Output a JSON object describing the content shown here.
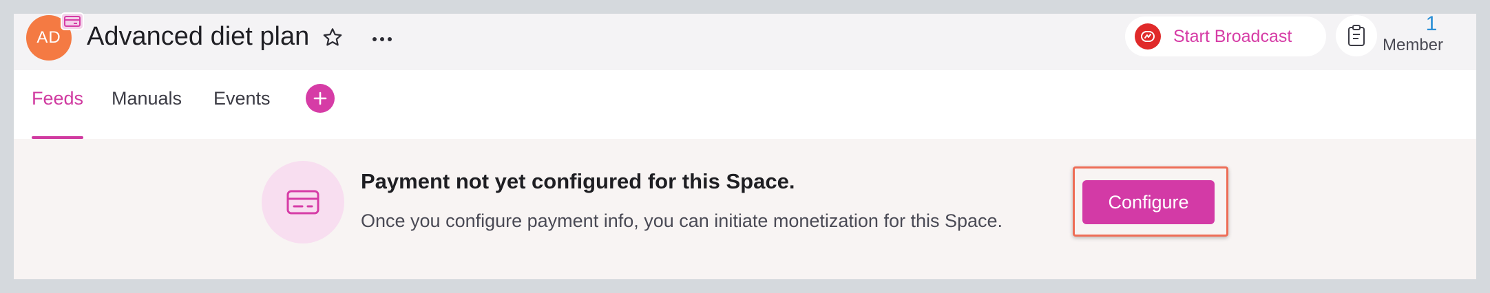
{
  "space": {
    "avatar_initials": "AD",
    "avatar_color": "#f47a43",
    "title": "Advanced diet plan"
  },
  "header": {
    "broadcast_label": "Start Broadcast",
    "member_count": "1",
    "member_label": "Member"
  },
  "tabs": [
    {
      "label": "Feeds",
      "active": true
    },
    {
      "label": "Manuals",
      "active": false
    },
    {
      "label": "Events",
      "active": false
    }
  ],
  "banner": {
    "title": "Payment not yet configured for this Space.",
    "description": "Once you configure payment info, you can initiate monetization for this Space.",
    "button_label": "Configure"
  },
  "colors": {
    "accent": "#d33aa6",
    "member_count": "#2a8fd6",
    "broadcast_icon": "#e02a2a",
    "highlight_border": "#ee6d56"
  },
  "icons": {
    "avatar_badge": "card-icon",
    "favorite": "star-icon",
    "more": "more-icon",
    "broadcast": "broadcast-icon",
    "members": "clipboard-icon",
    "add_tab": "plus-icon",
    "banner": "credit-card-icon"
  }
}
